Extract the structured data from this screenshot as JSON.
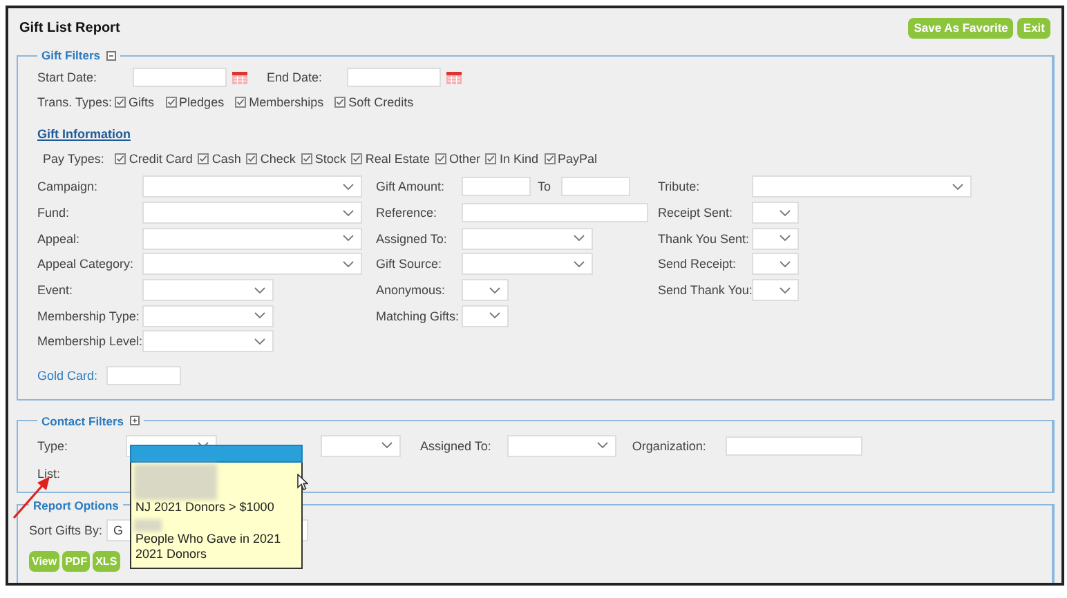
{
  "page": {
    "title": "Gift List Report"
  },
  "header_buttons": [
    "Save As Favorite",
    "Exit"
  ],
  "gift_filters": {
    "legend": "Gift Filters",
    "expanded": true,
    "start_date": {
      "label": "Start Date:"
    },
    "end_date": {
      "label": "End Date:"
    },
    "trans_types": {
      "label": "Trans. Types:",
      "options": [
        {
          "label": "Gifts",
          "checked": true
        },
        {
          "label": "Pledges",
          "checked": true
        },
        {
          "label": "Memberships",
          "checked": true
        },
        {
          "label": "Soft Credits",
          "checked": true
        }
      ]
    },
    "gift_information": {
      "heading": "Gift Information"
    },
    "pay_types": {
      "label": "Pay Types:",
      "options": [
        {
          "label": "Credit Card",
          "checked": true
        },
        {
          "label": "Cash",
          "checked": true
        },
        {
          "label": "Check",
          "checked": true
        },
        {
          "label": "Stock",
          "checked": true
        },
        {
          "label": "Real Estate",
          "checked": true
        },
        {
          "label": "Other",
          "checked": true
        },
        {
          "label": "In Kind",
          "checked": true
        },
        {
          "label": "PayPal",
          "checked": true
        }
      ]
    },
    "columns": [
      [
        {
          "label": "Campaign:",
          "kind": "longselect"
        },
        {
          "label": "Fund:",
          "kind": "longselect"
        },
        {
          "label": "Appeal:",
          "kind": "longselect"
        },
        {
          "label": "Appeal Category:",
          "kind": "longselect"
        },
        {
          "label": "Event:",
          "kind": "select"
        },
        {
          "label": "Membership Type:",
          "kind": "select"
        },
        {
          "label": "Membership Level:",
          "kind": "select"
        }
      ],
      [
        {
          "label": "Gift Amount:",
          "kind": "range",
          "to_label": "To"
        },
        {
          "label": "Reference:",
          "kind": "text"
        },
        {
          "label": "Assigned To:",
          "kind": "select"
        },
        {
          "label": "Gift Source:",
          "kind": "select"
        },
        {
          "label": "Anonymous:",
          "kind": "tinyselect"
        },
        {
          "label": "Matching Gifts:",
          "kind": "tinyselect"
        }
      ],
      [
        {
          "label": "Tribute:",
          "kind": "longselect"
        },
        {
          "label": "Receipt Sent:",
          "kind": "tinyselect"
        },
        {
          "label": "Thank You Sent:",
          "kind": "tinyselect"
        },
        {
          "label": "Send Receipt:",
          "kind": "tinyselect"
        },
        {
          "label": "Send Thank You:",
          "kind": "tinyselect"
        }
      ]
    ],
    "gold_card": {
      "label": "Gold Card:"
    }
  },
  "contact_filters": {
    "legend": "Contact Filters",
    "expanded": false,
    "type": {
      "label": "Type:"
    },
    "assigned_to": {
      "label": "Assigned To:"
    },
    "organization": {
      "label": "Organization:"
    },
    "list": {
      "label": "List:"
    }
  },
  "report_options": {
    "legend": "Report Options",
    "sort_label": "Sort Gifts By:",
    "sort_value": "G",
    "buttons": [
      "View",
      "PDF",
      "XLS"
    ]
  },
  "list_dropdown": {
    "options": [
      {
        "kind": "highlight",
        "selected": true
      },
      {
        "kind": "redacted",
        "selected": false
      },
      {
        "kind": "text",
        "label": "NJ 2021 Donors > $1000",
        "selected": false
      },
      {
        "kind": "redacted",
        "selected": false
      },
      {
        "kind": "text",
        "label": "People Who Gave in 2021",
        "selected": false
      },
      {
        "kind": "text",
        "label": "2021 Donors",
        "selected": false
      }
    ]
  }
}
